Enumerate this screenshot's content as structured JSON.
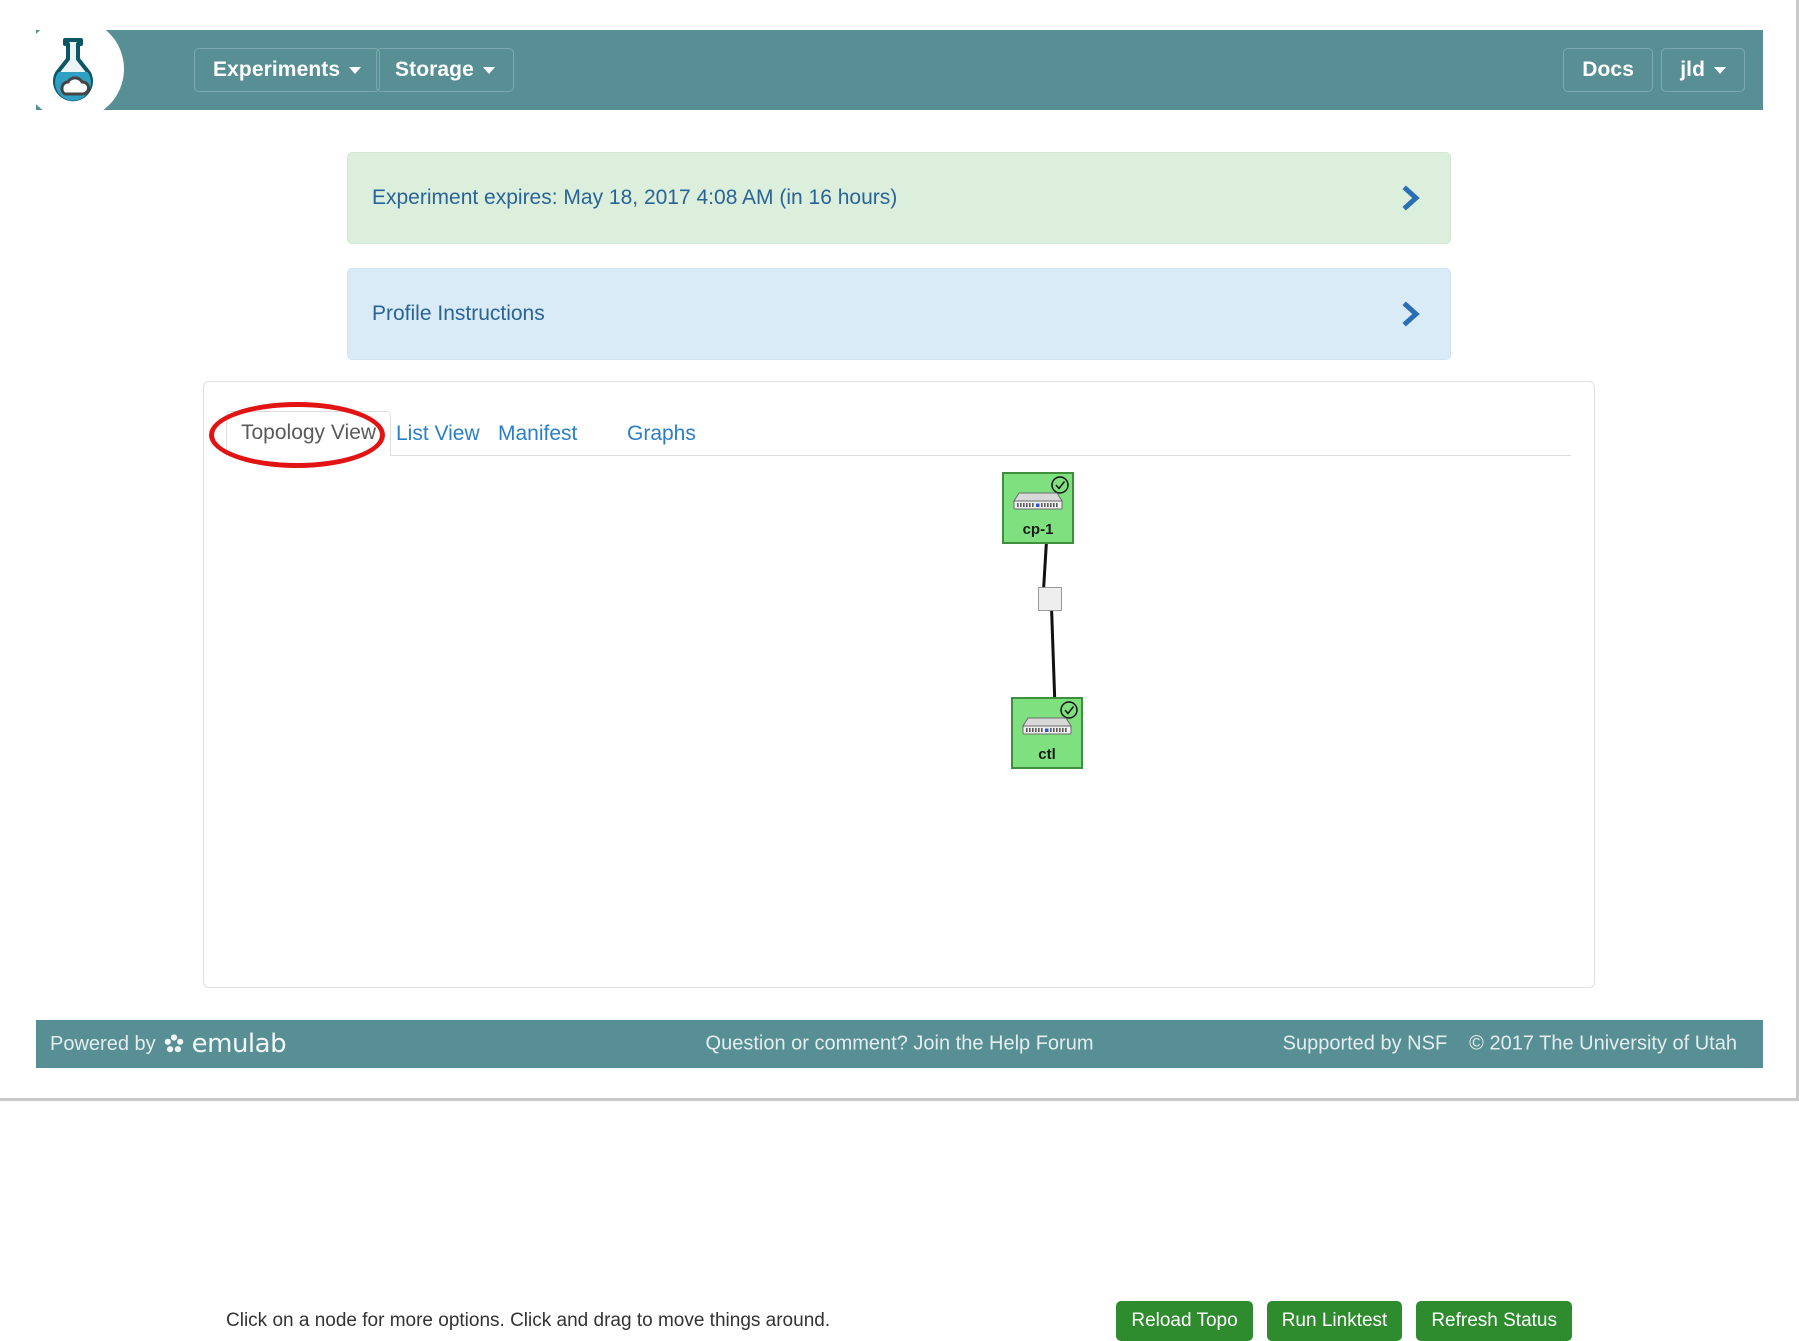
{
  "navbar": {
    "logo_icon": "flask-cloud-logo",
    "brand_color": "#588f95",
    "items": [
      {
        "label": "Experiments",
        "icon": "caret-down-icon"
      },
      {
        "label": "Storage",
        "icon": "caret-down-icon"
      }
    ],
    "docs_label": "Docs",
    "user_label": "jld",
    "user_caret_icon": "caret-down-icon"
  },
  "alerts": [
    {
      "id": "experiment-expires",
      "text": "Experiment expires: May 18, 2017 4:08 AM (in 16 hours)",
      "chevron_icon": "chevron-right-icon",
      "bg_color": "#dceedc",
      "text_color": "#2a6496"
    },
    {
      "id": "profile-instructions",
      "text": "Profile Instructions",
      "chevron_icon": "chevron-right-icon",
      "bg_color": "#d9ebf7",
      "text_color": "#2a6496"
    }
  ],
  "tabs": [
    {
      "label": "Topology View",
      "active": true
    },
    {
      "label": "List View",
      "active": false
    },
    {
      "label": "Manifest",
      "active": false
    },
    {
      "label": "Graphs",
      "active": false
    }
  ],
  "annotation": {
    "shape": "ellipse",
    "color": "#e21313",
    "target": "Topology View"
  },
  "topology": {
    "nodes": [
      {
        "id": "cp-1",
        "label": "cp-1",
        "status": "ready",
        "status_icon": "check-circle-icon",
        "device_icon": "server-icon",
        "color": "#7fe07f"
      },
      {
        "id": "ctl",
        "label": "ctl",
        "status": "ready",
        "status_icon": "check-circle-icon",
        "device_icon": "server-icon",
        "color": "#7fe07f"
      }
    ],
    "links": [
      {
        "from": "cp-1",
        "to": "ctl",
        "via": "link-box"
      }
    ]
  },
  "panel": {
    "hint": "Click on a node for more options. Click and drag to move things around.",
    "actions": [
      {
        "label": "Reload Topo",
        "color": "#2e8b2e"
      },
      {
        "label": "Run Linktest",
        "color": "#2e8b2e"
      },
      {
        "label": "Refresh Status",
        "color": "#2e8b2e"
      }
    ]
  },
  "footer": {
    "powered_by": "Powered by",
    "brand": "emulab",
    "brand_icon": "emulab-flower-icon",
    "help": "Question or comment? Join the Help Forum",
    "supported_by": "Supported by NSF",
    "copyright": "© 2017 The University of Utah"
  }
}
